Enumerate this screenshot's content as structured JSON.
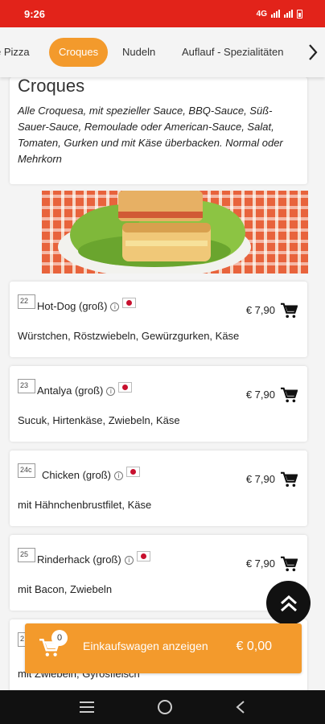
{
  "status_bar": {
    "time": "9:26",
    "network": "4G"
  },
  "tabs": [
    {
      "label": "e Pizza",
      "active": false
    },
    {
      "label": "Croques",
      "active": true
    },
    {
      "label": "Nudeln",
      "active": false
    },
    {
      "label": "Auflauf - Spezialitäten",
      "active": false
    }
  ],
  "category": {
    "title": "Croques",
    "description": "Alle Croquesa, mit spezieller Sauce, BBQ-Sauce, Süß-Sauer-Sauce, Remoulade oder American-Sauce, Salat, Tomaten, Gurken und mit Käse überbacken. Normal oder Mehrkorn"
  },
  "products": [
    {
      "number": "22",
      "name": "Hot-Dog (groß)",
      "price": "€ 7,90",
      "description": "Würstchen, Röstzwiebeln, Gewürzgurken, Käse"
    },
    {
      "number": "23",
      "name": "Antalya (groß)",
      "price": "€ 7,90",
      "description": "Sucuk, Hirtenkäse, Zwiebeln, Käse"
    },
    {
      "number": "24c",
      "name": "Chicken (groß)",
      "price": "€ 7,90",
      "description": "mit Hähnchenbrustfilet, Käse"
    },
    {
      "number": "25",
      "name": "Rinderhack (groß)",
      "price": "€ 7,90",
      "description": "mit Bacon, Zwiebeln"
    },
    {
      "number": "2",
      "name": "",
      "price": "",
      "description": "mit Zwiebeln, Gyrosfleisch"
    }
  ],
  "cart": {
    "count": "0",
    "label": "Einkaufswagen anzeigen",
    "total": "€ 0,00"
  },
  "colors": {
    "status_bar": "#e2231a",
    "accent": "#f39a2c"
  },
  "icons": [
    "shopping-cart-icon",
    "info-icon",
    "chevron-right-icon",
    "double-chevron-up-icon",
    "menu-icon",
    "home-circle-icon",
    "back-icon"
  ]
}
